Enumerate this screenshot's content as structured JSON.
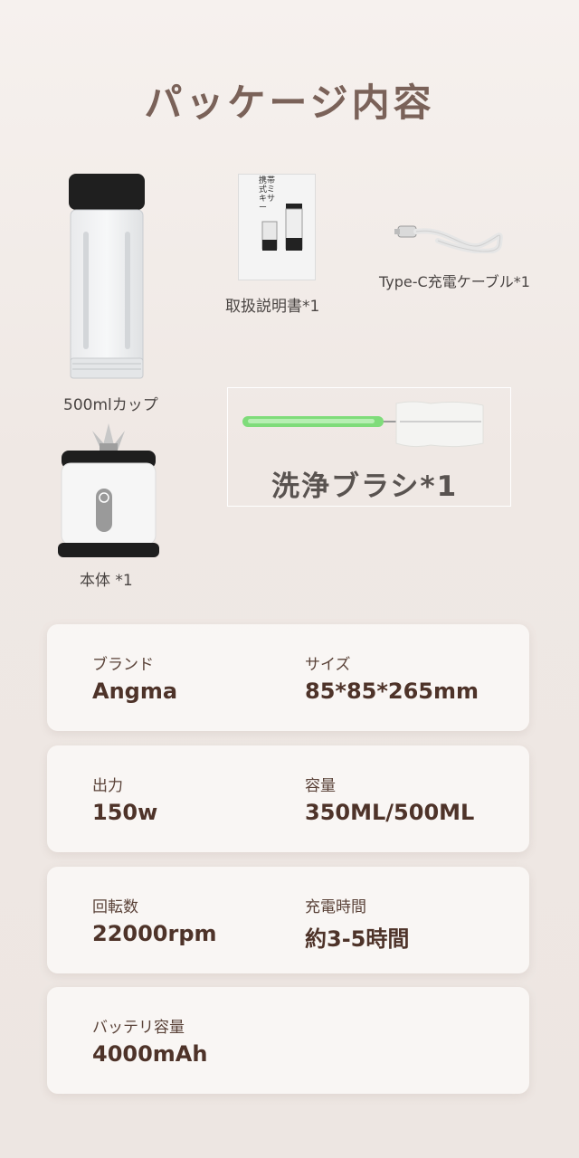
{
  "title": "パッケージ内容",
  "colors": {
    "title": "#7a6259",
    "spec_text": "#4e3329",
    "accent_green": "#6fd06a"
  },
  "items": {
    "cup": "500mlカップ",
    "manual": "取扱説明書*1",
    "manual_cover_title": "携帯式ミキサー",
    "cable": "Type-C充電ケーブル*1",
    "brush": "洗浄ブラシ*1",
    "base": "本体 *1"
  },
  "specs": [
    {
      "label": "ブランド",
      "value": "Angma",
      "label2": "サイズ",
      "value2": "85*85*265mm"
    },
    {
      "label": "出力",
      "value": "150w",
      "label2": "容量",
      "value2": "350ML/500ML"
    },
    {
      "label": "回転数",
      "value": "22000rpm",
      "label2": "充電時間",
      "value2": "約3-5時間"
    },
    {
      "label": "バッテリ容量",
      "value": "4000mAh"
    }
  ]
}
